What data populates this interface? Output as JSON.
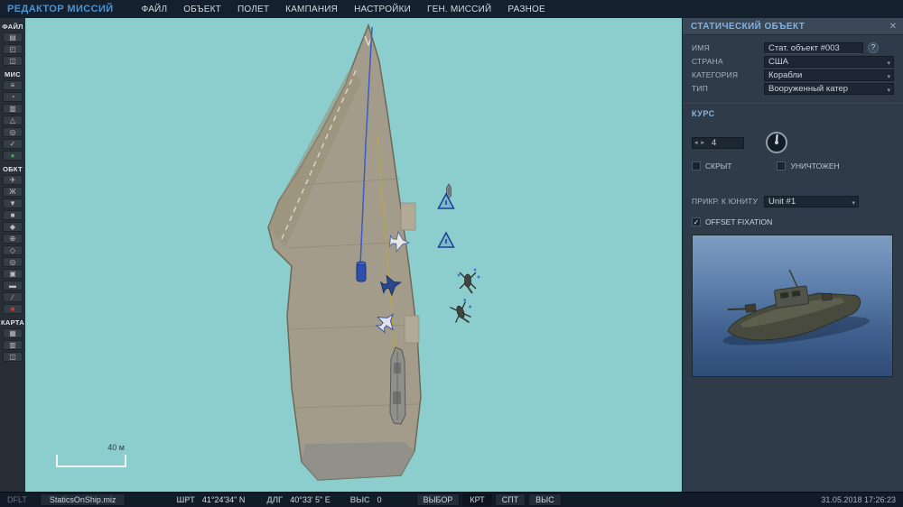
{
  "app": {
    "title": "РЕДАКТОР МИССИЙ"
  },
  "menu": {
    "items": [
      "ФАЙЛ",
      "ОБЪЕКТ",
      "ПОЛЕТ",
      "КАМПАНИЯ",
      "НАСТРОЙКИ",
      "ГЕН. МИССИЙ",
      "РАЗНОЕ"
    ]
  },
  "ui": {
    "select_arrow": "▾"
  },
  "toolbar": {
    "groups": [
      {
        "label": "ФАЙЛ",
        "items": [
          {
            "name": "new-mission-icon",
            "glyph": "▤"
          },
          {
            "name": "open-mission-icon",
            "glyph": "◰"
          },
          {
            "name": "save-mission-icon",
            "glyph": "◫"
          }
        ]
      },
      {
        "label": "МИС",
        "items": [
          {
            "name": "mission-list-icon",
            "glyph": "≡"
          },
          {
            "name": "weather-icon",
            "glyph": "◔"
          },
          {
            "name": "briefing-icon",
            "glyph": "▥"
          },
          {
            "name": "triggers-icon",
            "glyph": "△"
          },
          {
            "name": "rules-icon",
            "glyph": "◎"
          },
          {
            "name": "check-mission-icon",
            "glyph": "✓"
          }
        ]
      },
      {
        "label": "",
        "items": [
          {
            "name": "start-mission-icon",
            "glyph": "●",
            "fg": "#3fae5a"
          }
        ]
      },
      {
        "label": "ОБКТ",
        "items": [
          {
            "name": "aircraft-icon",
            "glyph": "✈"
          },
          {
            "name": "helicopter-icon",
            "glyph": "Ж"
          },
          {
            "name": "ship-icon",
            "glyph": "▼"
          },
          {
            "name": "vehicle-icon",
            "glyph": "■"
          },
          {
            "name": "static-object-icon",
            "glyph": "◆"
          },
          {
            "name": "airfield-icon",
            "glyph": "⊕"
          },
          {
            "name": "route-icon",
            "glyph": "◇"
          },
          {
            "name": "zone-icon",
            "glyph": "◎"
          },
          {
            "name": "template-icon",
            "glyph": "▣"
          },
          {
            "name": "label-icon",
            "glyph": "▬"
          },
          {
            "name": "measure-icon",
            "glyph": "∕"
          },
          {
            "name": "delete-object-icon",
            "glyph": "■",
            "fg": "#c23b34"
          }
        ]
      },
      {
        "label": "КАРТА",
        "items": [
          {
            "name": "map-layers-icon",
            "glyph": "▦"
          },
          {
            "name": "map-grid-icon",
            "glyph": "▥"
          },
          {
            "name": "map-info-icon",
            "glyph": "◫"
          }
        ]
      }
    ]
  },
  "map": {
    "scale_label": "40 м"
  },
  "panel": {
    "title": "СТАТИЧЕСКИЙ ОБЪЕКТ",
    "close_glyph": "✕",
    "fields": {
      "name_label": "ИМЯ",
      "name_value": "Стат. объект #003",
      "help_glyph": "?",
      "country_label": "СТРАНА",
      "country_value": "США",
      "category_label": "КАТЕГОРИЯ",
      "category_value": "Корабли",
      "type_label": "ТИП",
      "type_value": "Вооруженный катер"
    },
    "course": {
      "label": "КУРС",
      "value": "4",
      "dec_glyph": "◂",
      "inc_glyph": "▸"
    },
    "flags": {
      "hidden_label": "СКРЫТ",
      "hidden": false,
      "destroyed_label": "УНИЧТОЖЕН",
      "destroyed": false
    },
    "link": {
      "label": "ПРИКР. К ЮНИТУ",
      "value": "Unit #1"
    },
    "offset": {
      "label": "OFFSET FIXATION",
      "checked": true,
      "check_glyph": "✓"
    }
  },
  "statusbar": {
    "mode": "DFLT",
    "file": "StaticsOnShip.miz",
    "lat_label": "ШРТ",
    "lat_value": "41°24'34\" N",
    "lon_label": "ДЛГ",
    "lon_value": "40°33' 5\" E",
    "alt_label": "ВЫС",
    "alt_value": "0",
    "select_label": "ВЫБОР",
    "toggles": [
      "КРТ",
      "СПТ",
      "ВЫС"
    ],
    "datetime": "31.05.2018 17:26:23"
  },
  "colors": {
    "accent_green": "#3fae5a",
    "accent_red": "#c23b34",
    "map_water": "#8ccecd",
    "panel_bg": "#2f3b49",
    "title_blue": "#4b93d1"
  }
}
